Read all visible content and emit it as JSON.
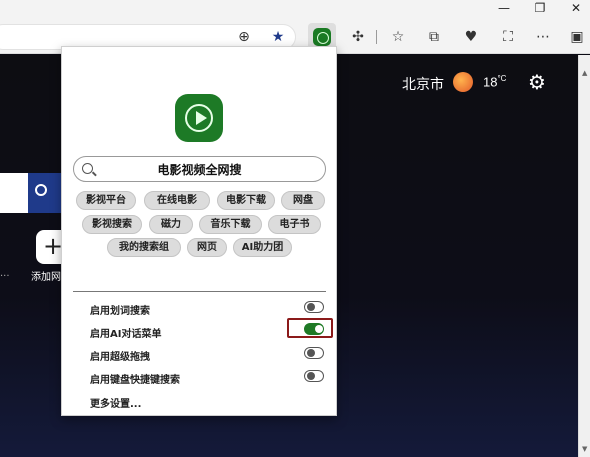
{
  "window_controls": {
    "minimize": "—",
    "maximize": "❐",
    "close": "✕"
  },
  "toolbar": {
    "zoom_icon": "magnify-plus-icon",
    "favorite_icon": "star-icon",
    "extension_icon": "video-search-extension-icon",
    "extensions_icon": "puzzle-icon",
    "favorites_icon": "favorites-icon",
    "collections_icon": "collections-icon",
    "health_icon": "heart-icon",
    "screenshot_icon": "screenshot-icon",
    "more_icon": "more-icon",
    "sidebar_icon": "sidebar-icon"
  },
  "page": {
    "city": "北京市",
    "temperature": "18",
    "temperature_unit": "°C",
    "add_label": "添加网",
    "left_ellipsis": "..."
  },
  "popup": {
    "search_text": "电影视频全网搜",
    "chips": [
      {
        "label": "影视平台"
      },
      {
        "label": "在线电影"
      },
      {
        "label": "电影下载"
      },
      {
        "label": "网盘"
      },
      {
        "label": "影视搜索"
      },
      {
        "label": "磁力"
      },
      {
        "label": "音乐下载"
      },
      {
        "label": "电子书"
      },
      {
        "label": "我的搜索组"
      },
      {
        "label": "网页"
      },
      {
        "label": "AI助力团"
      }
    ],
    "settings": [
      {
        "label": "启用划词搜索",
        "on": false
      },
      {
        "label": "启用AI对话菜单",
        "on": true
      },
      {
        "label": "启用超级拖拽",
        "on": false
      },
      {
        "label": "启用键盘快捷键搜索",
        "on": false
      }
    ],
    "more_settings": "更多设置..."
  },
  "colors": {
    "accent_green": "#1d7a26",
    "highlight_red": "#8b1a1a",
    "search_blue": "#1f3a8a"
  }
}
